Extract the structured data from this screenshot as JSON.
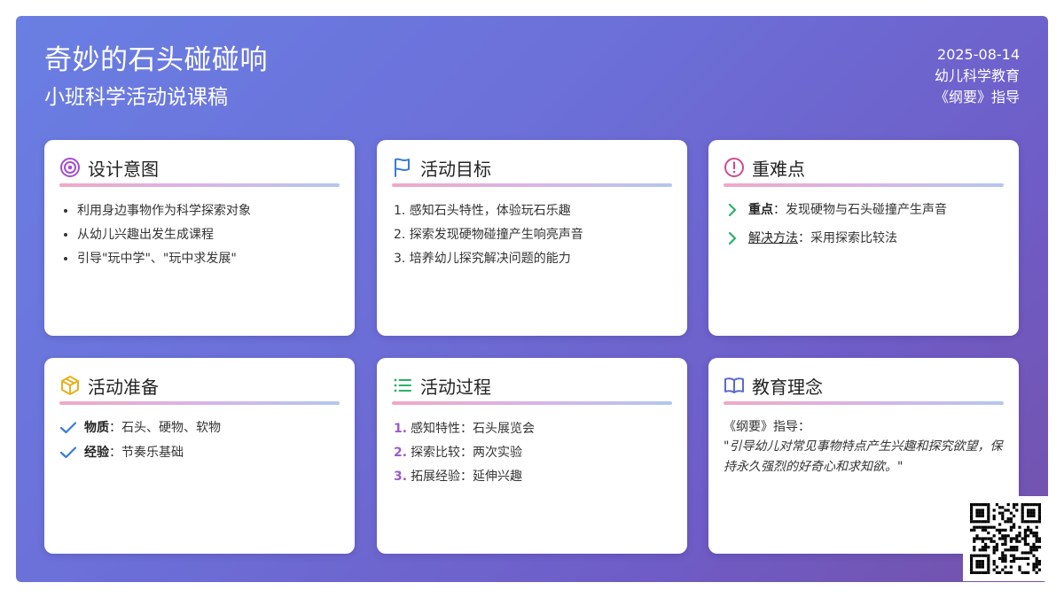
{
  "header": {
    "title": "奇妙的石头碰碰响",
    "subtitle": "小班科学活动说课稿",
    "date": "2025-08-14",
    "category": "幼儿科学教育",
    "guide": "《纲要》指导"
  },
  "cards": {
    "design": {
      "title": "设计意图",
      "icon": "target-icon",
      "items": [
        "利用身边事物作为科学探索对象",
        "从幼儿兴趣出发生成课程",
        "引导\"玩中学\"、\"玩中求发展\""
      ]
    },
    "goals": {
      "title": "活动目标",
      "icon": "flag-icon",
      "items": [
        "1. 感知石头特性，体验玩石乐趣",
        "2. 探索发现硬物碰撞产生响亮声音",
        "3. 培养幼儿探究解决问题的能力"
      ]
    },
    "keypoints": {
      "title": "重难点",
      "icon": "alert-circle-icon",
      "key_label": "重点",
      "key_text": "：发现硬物与石头碰撞产生声音",
      "solution_label": "解决方法",
      "solution_text": "：采用探索比较法"
    },
    "prep": {
      "title": "活动准备",
      "icon": "box-icon",
      "material_label": "物质",
      "material_text": "：石头、硬物、软物",
      "experience_label": "经验",
      "experience_text": "：节奏乐基础"
    },
    "process": {
      "title": "活动过程",
      "icon": "list-icon",
      "steps": [
        {
          "num": "1.",
          "text": "感知特性：石头展览会"
        },
        {
          "num": "2.",
          "text": "探索比较：两次实验"
        },
        {
          "num": "3.",
          "text": "拓展经验：延伸兴趣"
        }
      ]
    },
    "philosophy": {
      "title": "教育理念",
      "icon": "book-icon",
      "intro": "《纲要》指导：",
      "quote": "\"引导幼儿对常见事物特点产生兴趣和探究欲望，保持永久强烈的好奇心和求知欲。\""
    }
  },
  "colors": {
    "gradient_start": "#6a7fe3",
    "gradient_end": "#7451aa",
    "accent_purple": "#9b5cc9",
    "accent_blue": "#3a7bd5",
    "accent_green": "#2bb06b",
    "accent_pink": "#d04a8a",
    "accent_yellow": "#e5b21c"
  }
}
